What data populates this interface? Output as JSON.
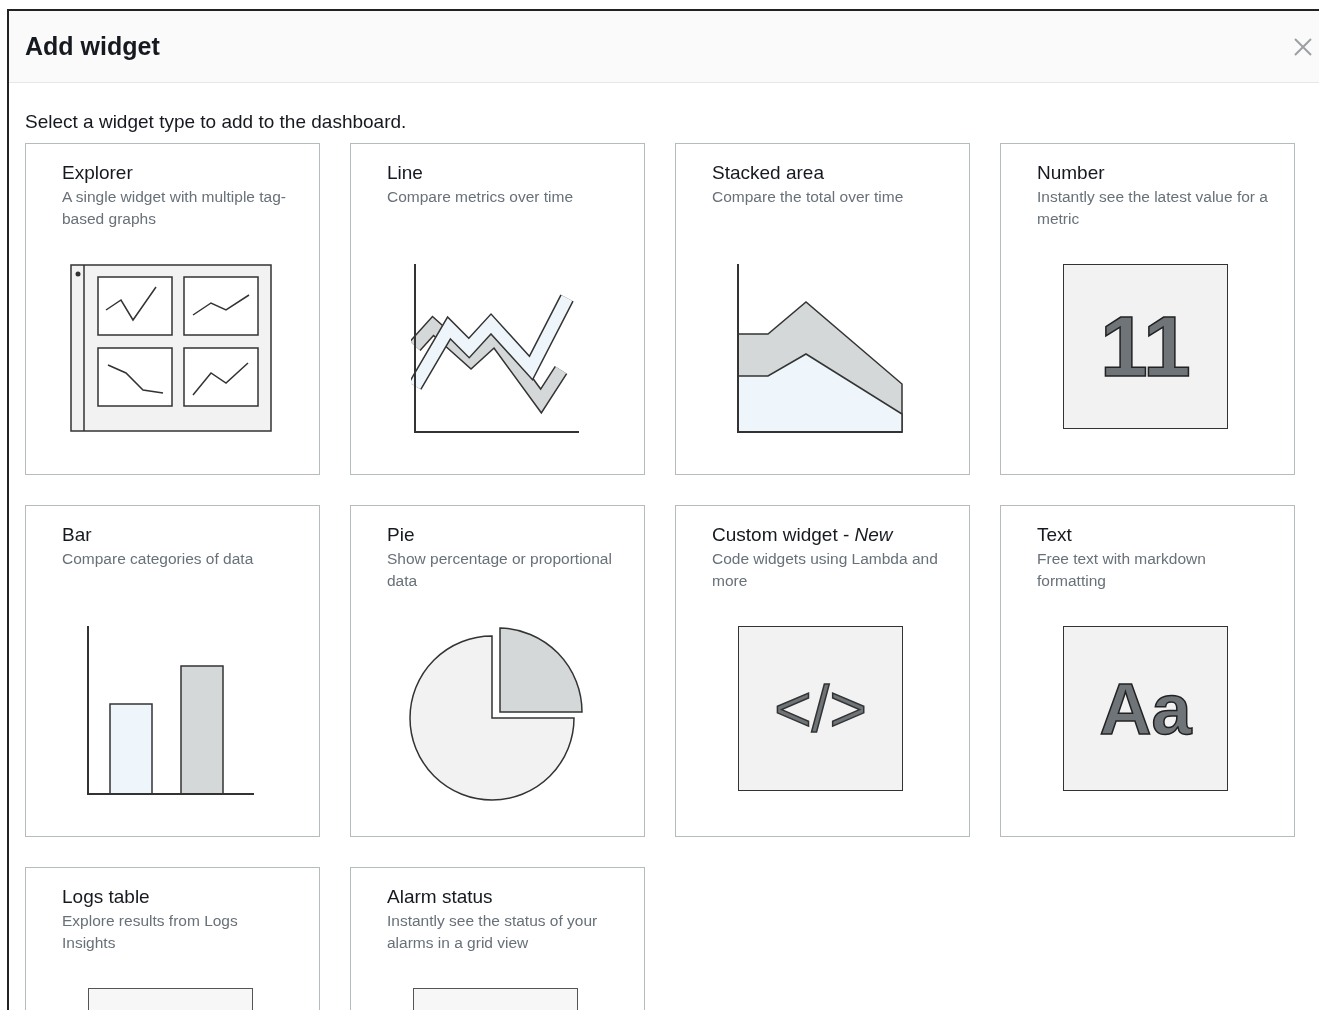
{
  "dialog": {
    "title": "Add widget",
    "intro": "Select a widget type to add to the dashboard."
  },
  "widgets": [
    {
      "kind": "explorer",
      "title": "Explorer",
      "description": "A single widget with multiple tag-based graphs"
    },
    {
      "kind": "line",
      "title": "Line",
      "description": "Compare metrics over time"
    },
    {
      "kind": "stacked",
      "title": "Stacked area",
      "description": "Compare the total over time"
    },
    {
      "kind": "number",
      "title": "Number",
      "description": "Instantly see the latest value for a metric",
      "glyph": "11"
    },
    {
      "kind": "bar",
      "title": "Bar",
      "description": "Compare categories of data"
    },
    {
      "kind": "pie",
      "title": "Pie",
      "description": "Show percentage or proportional data"
    },
    {
      "kind": "code",
      "title": "Custom widget - *New*",
      "description": "Code widgets using Lambda and more",
      "glyph": "</>"
    },
    {
      "kind": "text",
      "title": "Text",
      "description": "Free text with markdown formatting",
      "glyph": "Aa"
    },
    {
      "kind": "logs",
      "title": "Logs table",
      "description": "Explore results from Logs Insights"
    },
    {
      "kind": "alarm",
      "title": "Alarm status",
      "description": "Instantly see the status of your alarms in a grid view"
    }
  ]
}
